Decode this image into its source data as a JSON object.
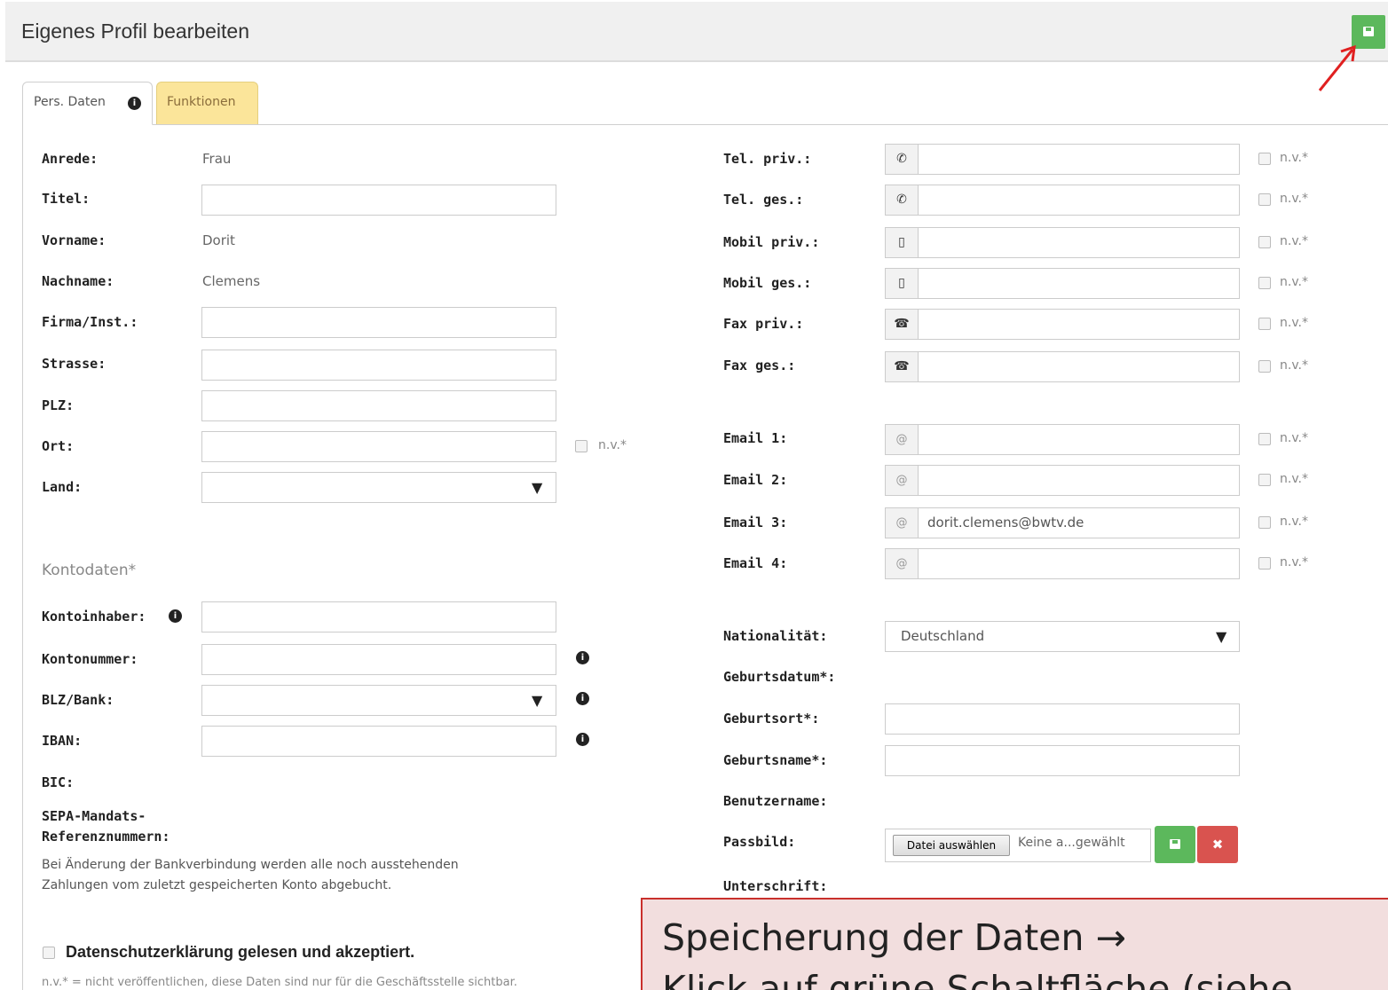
{
  "header": {
    "title": "Eigenes Profil bearbeiten"
  },
  "tabs": {
    "pers": "Pers. Daten",
    "funktionen": "Funktionen",
    "info_icon": "i"
  },
  "left": {
    "anrede_label": "Anrede:",
    "anrede_value": "Frau",
    "titel_label": "Titel:",
    "vorname_label": "Vorname:",
    "vorname_value": "Dorit",
    "nachname_label": "Nachname:",
    "nachname_value": "Clemens",
    "firma_label": "Firma/Inst.:",
    "strasse_label": "Strasse:",
    "plz_label": "PLZ:",
    "ort_label": "Ort:",
    "land_label": "Land:",
    "nv": "n.v.*"
  },
  "konto": {
    "heading": "Kontodaten*",
    "inhaber_label": "Kontoinhaber:",
    "nummer_label": "Kontonummer:",
    "blz_label": "BLZ/Bank:",
    "iban_label": "IBAN:",
    "bic_label": "BIC:",
    "sepa_label_1": "SEPA-Mandats-",
    "sepa_label_2": "Referenznummern:",
    "note_1": "Bei Änderung der Bankverbindung werden alle noch ausstehenden",
    "note_2": "Zahlungen vom zuletzt gespeicherten Konto abgebucht."
  },
  "privacy": {
    "checkbox_label": "Datenschutzerklärung gelesen und akzeptiert.",
    "footnote": "n.v.* = nicht veröffentlichen, diese Daten sind nur für die Geschäftsstelle sichtbar."
  },
  "right": {
    "tel_priv": "Tel. priv.:",
    "tel_ges": "Tel. ges.:",
    "mobil_priv": "Mobil priv.:",
    "mobil_ges": "Mobil ges.:",
    "fax_priv": "Fax priv.:",
    "fax_ges": "Fax ges.:",
    "email1": "Email 1:",
    "email2": "Email 2:",
    "email3": "Email 3:",
    "email3_value": "dorit.clemens@bwtv.de",
    "email4": "Email 4:",
    "nationalitaet_label": "Nationalität:",
    "nationalitaet_value": "Deutschland",
    "geburtsdatum": "Geburtsdatum*:",
    "geburtsort": "Geburtsort*:",
    "geburtsname": "Geburtsname*:",
    "benutzername": "Benutzername:",
    "passbild": "Passbild:",
    "unterschrift": "Unterschrift:",
    "file_button": "Datei auswählen",
    "file_status": "Keine a...gewählt",
    "nv": "n.v.*",
    "at": "@",
    "remove": "✖"
  },
  "callout": {
    "line1": "Speicherung der Daten →",
    "line2": "Klick auf grüne Schaltfläche (siehe"
  },
  "colors": {
    "green": "#5cb85c",
    "red": "#d9534f",
    "tab_yellow": "#fbe59a",
    "callout_bg": "#f2dede",
    "arrow": "#e02020"
  }
}
